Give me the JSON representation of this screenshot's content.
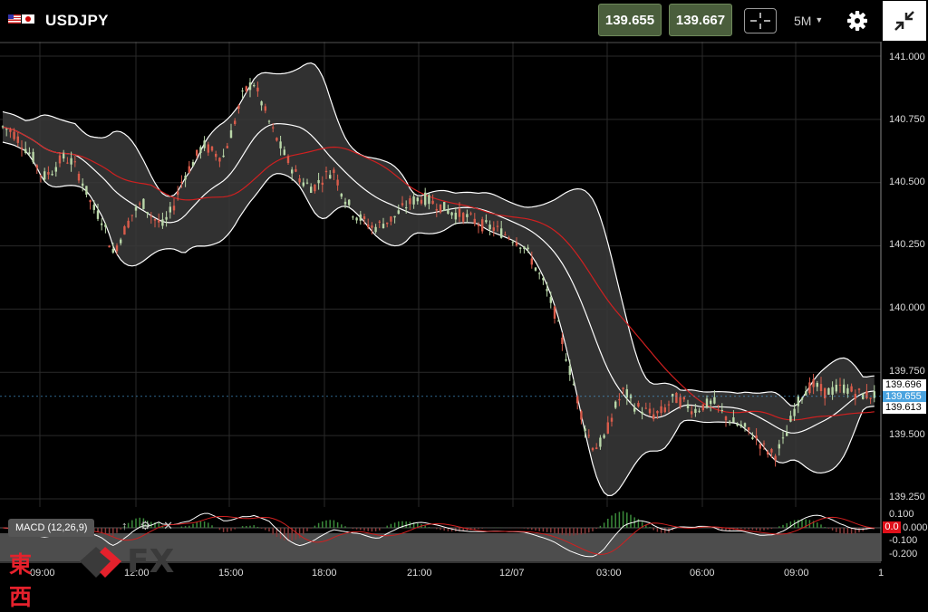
{
  "header": {
    "symbol": "USDJPY",
    "bid": "139.655",
    "ask": "139.667",
    "timeframe": "5M"
  },
  "icons": {
    "flag_base": "us-flag-icon",
    "flag_quote": "japan-flag-icon",
    "crosshair": "crosshair-icon",
    "dropdown": "caret-down-icon",
    "settings": "gear-icon",
    "collapse": "collapse-icon"
  },
  "price_tags": {
    "upper_band": "139.696",
    "last": "139.655",
    "lower_band": "139.613"
  },
  "macd": {
    "label": "MACD (12,26,9)",
    "value_tag": "0.0"
  },
  "logo": {
    "kanji": "東西",
    "fx": "FX"
  },
  "colors": {
    "background": "#000000",
    "bull_candle": "#b9d7a8",
    "bear_candle": "#d95c4b",
    "band_fill": "#3a3a3a",
    "band_line": "#ffffff",
    "ma_line": "#d02020",
    "last_price": "#4aa3df",
    "buttons": "#4a5e3c"
  },
  "chart_data": {
    "type": "candlestick",
    "y_ticks": [
      "141.000",
      "140.750",
      "140.500",
      "140.250",
      "140.000",
      "139.750",
      "139.500",
      "139.250"
    ],
    "x_ticks": [
      "09:00",
      "12:00",
      "15:00",
      "18:00",
      "21:00",
      "12/07",
      "03:00",
      "06:00",
      "09:00",
      "1"
    ],
    "macd_ticks": [
      "0.100",
      "0.000",
      "-0.100",
      "-0.200"
    ],
    "ylim": [
      139.22,
      141.02
    ],
    "price_path": [
      140.72,
      140.7,
      140.65,
      140.6,
      140.52,
      140.55,
      140.6,
      140.58,
      140.5,
      140.4,
      140.35,
      140.22,
      140.3,
      140.38,
      140.42,
      140.36,
      140.33,
      140.4,
      140.52,
      140.58,
      140.65,
      140.62,
      140.6,
      140.72,
      140.85,
      140.9,
      140.8,
      140.7,
      140.62,
      140.55,
      140.5,
      140.48,
      140.52,
      140.55,
      140.45,
      140.38,
      140.35,
      140.32,
      140.34,
      140.36,
      140.4,
      140.43,
      140.44,
      140.42,
      140.4,
      140.38,
      140.37,
      140.35,
      140.33,
      140.32,
      140.3,
      140.28,
      140.25,
      140.18,
      140.1,
      140.0,
      139.85,
      139.7,
      139.55,
      139.45,
      139.48,
      139.6,
      139.68,
      139.62,
      139.6,
      139.58,
      139.6,
      139.65,
      139.63,
      139.6,
      139.62,
      139.63,
      139.58,
      139.55,
      139.53,
      139.5,
      139.45,
      139.42,
      139.48,
      139.6,
      139.68,
      139.7,
      139.67,
      139.68,
      139.69,
      139.67,
      139.66,
      139.66
    ],
    "bands": [
      "bollinger_upper",
      "bollinger_middle",
      "bollinger_lower",
      "moving_average"
    ],
    "grid": true
  }
}
